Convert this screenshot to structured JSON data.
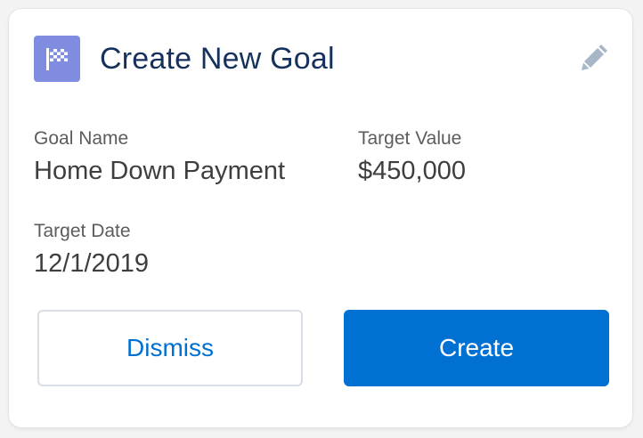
{
  "card": {
    "title": "Create New Goal",
    "icon": "checkered-flag-icon",
    "edit_icon": "pencil-icon"
  },
  "fields": {
    "goal_name": {
      "label": "Goal Name",
      "value": "Home Down Payment"
    },
    "target_value": {
      "label": "Target Value",
      "value": "$450,000"
    },
    "target_date": {
      "label": "Target Date",
      "value": "12/1/2019"
    }
  },
  "actions": {
    "dismiss_label": "Dismiss",
    "create_label": "Create"
  },
  "colors": {
    "brand": "#0070d2",
    "icon_bg": "#7f8ce0",
    "title": "#16325c",
    "label": "#5c5c5c",
    "value": "#3e3e3c",
    "border": "#d8dde6"
  }
}
